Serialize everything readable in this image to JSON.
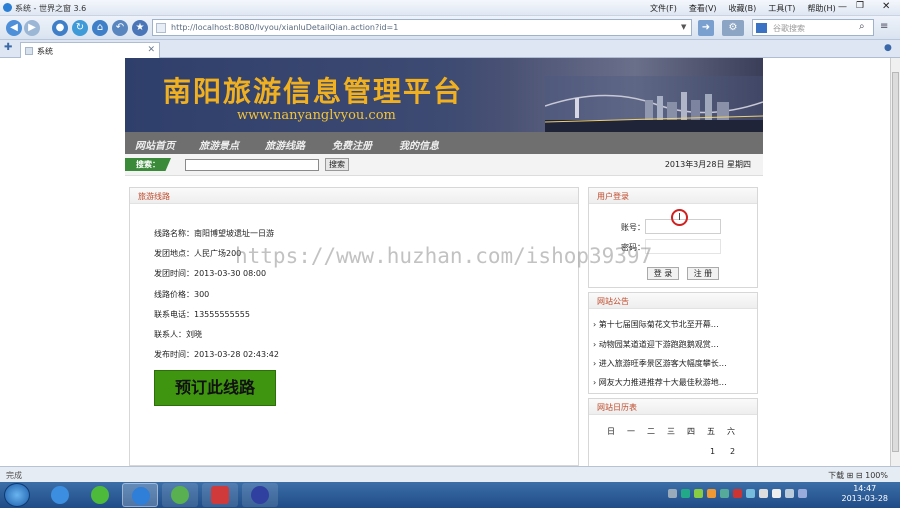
{
  "browser": {
    "window_title": "系统 - 世界之窗 3.6",
    "menu": [
      "文件(F)",
      "查看(V)",
      "收藏(B)",
      "工具(T)",
      "帮助(H)"
    ],
    "address": "http://localhost:8080/lvyou/xianluDetailQian.action?id=1",
    "search_placeholder": "谷歌搜索",
    "tab_label": "系统",
    "status_left": "完成",
    "status_right": "下载 ⊞ ⊟ 100%"
  },
  "site": {
    "title": "南阳旅游信息管理平台",
    "url": "www.nanyanglvyou.com",
    "nav": [
      "网站首页",
      "旅游景点",
      "旅游线路",
      "免费注册",
      "我的信息"
    ],
    "search_label": "搜索：",
    "search_button": "搜索",
    "date": "2013年3月28日 星期四"
  },
  "detail": {
    "header": "旅游线路",
    "rows": [
      "线路名称：南阳博望坡遗址一日游",
      "发团地点：人民广场200",
      "发团时间：2013-03-30 08:00",
      "线路价格：300",
      "联系电话：13555555555",
      "联系人：刘晓",
      "发布时间：2013-03-28 02:43:42"
    ],
    "book_button": "预订此线路"
  },
  "login": {
    "header": "用户登录",
    "account_label": "账号：",
    "password_label": "密码：",
    "login_button": "登 录",
    "register_button": "注 册"
  },
  "notice": {
    "header": "网站公告",
    "items": [
      "第十七届国际菊花文节北至开幕…",
      "动物园某道道迎下游跑跑鹅观赏…",
      "进入旅游旺季景区游客大幅度攀长…",
      "网友大力推进推荐十大最佳秋游地…"
    ]
  },
  "calendar": {
    "header": "网站日历表",
    "weekdays": [
      "日",
      "一",
      "二",
      "三",
      "四",
      "五",
      "六"
    ],
    "visible_days": [
      "1",
      "2"
    ]
  },
  "watermark": "https://www.huzhan.com/ishop39397",
  "taskbar": {
    "clock_time": "14:47",
    "clock_date": "2013-03-28"
  }
}
